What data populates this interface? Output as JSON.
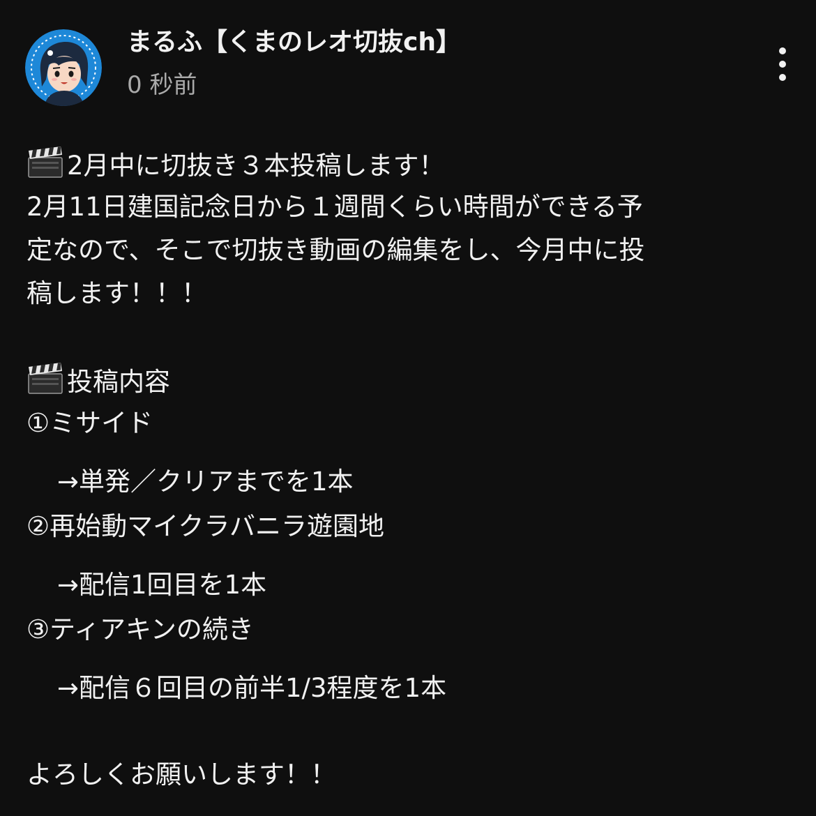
{
  "post": {
    "channel_name": "まるふ【くまのレオ切抜ch】",
    "timestamp": "0 秒前",
    "menu_icon": "more-vertical-icon",
    "avatar_icon": "channel-avatar"
  },
  "body": {
    "line1": "2月中に切抜き３本投稿します！",
    "line2": "2月11日建国記念日から１週間くらい時間ができる予",
    "line3": "定なので、そこで切抜き動画の編集をし、今月中に投",
    "line4": "稿します！！！",
    "heading": "投稿内容",
    "item1": "①ミサイド",
    "item1_detail": "→単発／クリアまでを1本",
    "item2": "②再始動マイクラバニラ遊園地",
    "item2_detail": "→配信1回目を1本",
    "item3": "③ティアキンの続き",
    "item3_detail": "→配信６回目の前半1/3程度を1本",
    "closing": "よろしくお願いします！！"
  },
  "colors": {
    "background": "#0f0f0f",
    "text_primary": "#f1f1f1",
    "text_secondary": "#aaaaaa",
    "avatar_ring": "#1e88d8"
  }
}
